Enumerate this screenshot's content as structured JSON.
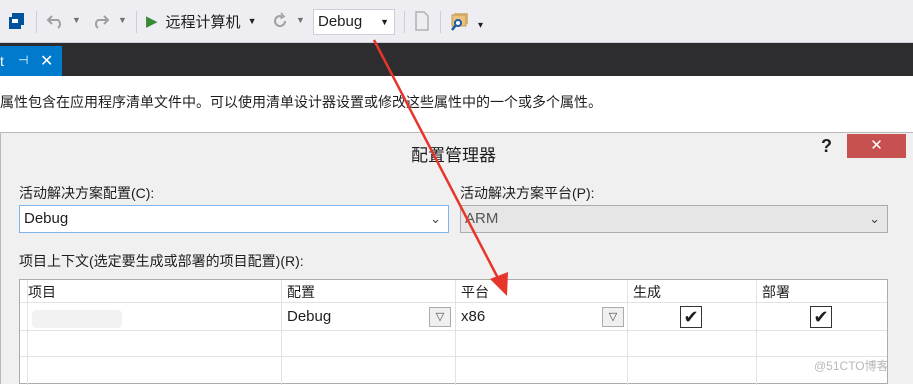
{
  "toolbar": {
    "run_label": "远程计算机",
    "config_value": "Debug"
  },
  "tab": {
    "title_fragment": "t",
    "pin_glyph": "⊣",
    "close_glyph": "✕"
  },
  "description": "属性包含在应用程序清单文件中。可以使用清单设计器设置或修改这些属性中的一个或多个属性。",
  "dialog": {
    "title": "配置管理器",
    "help_glyph": "?",
    "close_glyph": "✕",
    "solution_config_label": "活动解决方案配置(C):",
    "solution_config_value": "Debug",
    "solution_platform_label": "活动解决方案平台(P):",
    "solution_platform_value": "ARM",
    "project_context_label": "项目上下文(选定要生成或部署的项目配置)(R):",
    "columns": [
      "项目",
      "配置",
      "平台",
      "生成",
      "部署"
    ],
    "rows": [
      {
        "project": "",
        "config": "Debug",
        "platform": "x86",
        "build": "✔",
        "deploy": "✔"
      }
    ]
  },
  "watermark": "@51CTO博客",
  "colors": {
    "accent": "#007acc",
    "close_red": "#c75050",
    "annotation_arrow": "#e8352b"
  }
}
